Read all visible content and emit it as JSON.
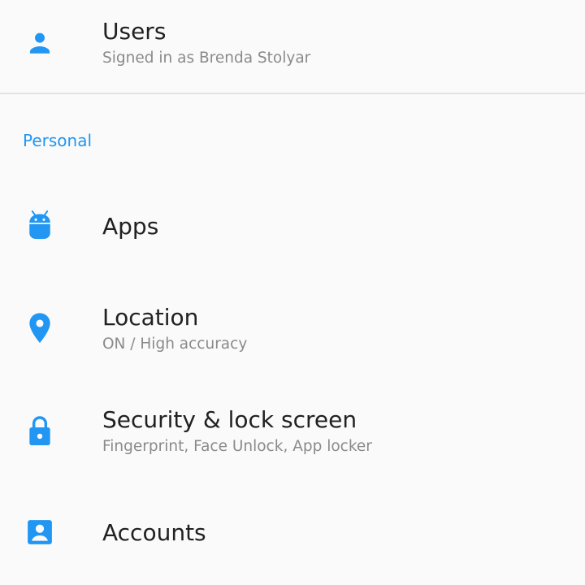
{
  "accent_color": "#2196f3",
  "items_top": {
    "users": {
      "title": "Users",
      "subtitle": "Signed in as Brenda Stolyar",
      "icon": "person-icon"
    }
  },
  "section": {
    "header": "Personal"
  },
  "items": {
    "apps": {
      "title": "Apps",
      "icon": "android-icon"
    },
    "location": {
      "title": "Location",
      "subtitle": "ON / High accuracy",
      "icon": "location-pin-icon"
    },
    "security": {
      "title": "Security & lock screen",
      "subtitle": "Fingerprint, Face Unlock, App locker",
      "icon": "lock-icon"
    },
    "accounts": {
      "title": "Accounts",
      "icon": "account-box-icon"
    }
  }
}
